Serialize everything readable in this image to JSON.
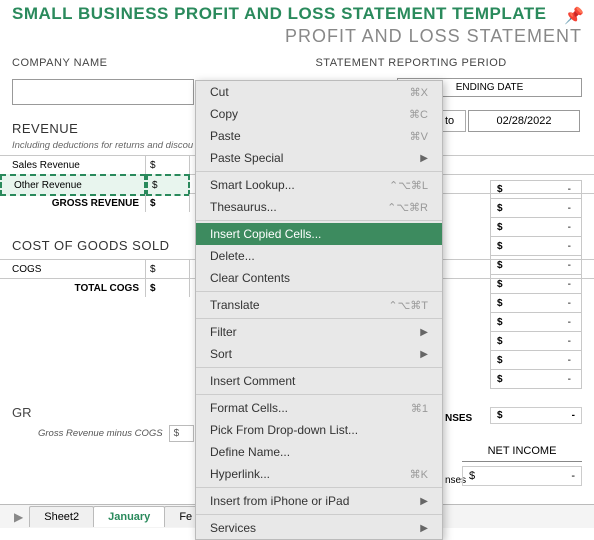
{
  "header": {
    "title": "SMALL BUSINESS PROFIT AND LOSS STATEMENT TEMPLATE",
    "subtitle": "PROFIT AND LOSS STATEMENT"
  },
  "labels": {
    "company": "COMPANY NAME",
    "statement_period": "STATEMENT REPORTING PERIOD",
    "ending_date": "ENDING DATE",
    "to": "to",
    "revenue": "REVENUE",
    "deductions": "Including deductions for returns and discou",
    "cogs": "COST OF GOODS SOLD",
    "gross_label": "GR",
    "gross_sub": "Gross Revenue minus COGS",
    "net_income": "NET INCOME",
    "nses": "nses",
    "nses2": "NSES"
  },
  "statement": {
    "ending_date_value": "02/28/2022"
  },
  "revenue_rows": [
    {
      "label": "Sales Revenue",
      "cur": "$"
    },
    {
      "label": "Other Revenue",
      "cur": "$",
      "selected": true
    },
    {
      "label": "GROSS REVENUE",
      "cur": "$",
      "bold": true
    }
  ],
  "cogs_rows": [
    {
      "label": "COGS",
      "cur": "$"
    },
    {
      "label": "TOTAL COGS",
      "cur": "$",
      "bold": true
    }
  ],
  "dollar_rows": [
    {
      "s": "$",
      "v": "-"
    },
    {
      "s": "$",
      "v": "-"
    },
    {
      "s": "$",
      "v": "-"
    },
    {
      "s": "$",
      "v": "-"
    },
    {
      "s": "$",
      "v": "-"
    },
    {
      "s": "$",
      "v": "-"
    },
    {
      "s": "$",
      "v": "-"
    },
    {
      "s": "$",
      "v": "-"
    },
    {
      "s": "$",
      "v": "-"
    },
    {
      "s": "$",
      "v": "-"
    },
    {
      "s": "$",
      "v": "-"
    }
  ],
  "netincome": {
    "s": "$",
    "v": "-"
  },
  "gross_mini": {
    "s": "$",
    "v": ""
  },
  "nses2box": {
    "s": "$",
    "v": "-"
  },
  "context_menu": [
    {
      "label": "Cut",
      "shortcut": "⌘X"
    },
    {
      "label": "Copy",
      "shortcut": "⌘C"
    },
    {
      "label": "Paste",
      "shortcut": "⌘V"
    },
    {
      "label": "Paste Special",
      "arrow": true
    },
    {
      "sep": true
    },
    {
      "label": "Smart Lookup...",
      "shortcut": "⌃⌥⌘L"
    },
    {
      "label": "Thesaurus...",
      "shortcut": "⌃⌥⌘R"
    },
    {
      "sep": true
    },
    {
      "label": "Insert Copied Cells...",
      "highlight": true
    },
    {
      "label": "Delete..."
    },
    {
      "label": "Clear Contents"
    },
    {
      "sep": true
    },
    {
      "label": "Translate",
      "shortcut": "⌃⌥⌘T"
    },
    {
      "sep": true
    },
    {
      "label": "Filter",
      "arrow": true
    },
    {
      "label": "Sort",
      "arrow": true
    },
    {
      "sep": true
    },
    {
      "label": "Insert Comment"
    },
    {
      "sep": true
    },
    {
      "label": "Format Cells...",
      "shortcut": "⌘1"
    },
    {
      "label": "Pick From Drop-down List..."
    },
    {
      "label": "Define Name..."
    },
    {
      "label": "Hyperlink...",
      "shortcut": "⌘K"
    },
    {
      "sep": true
    },
    {
      "label": "Insert from iPhone or iPad",
      "arrow": true
    },
    {
      "sep": true
    },
    {
      "label": "Services",
      "arrow": true
    }
  ],
  "tabs": {
    "items": [
      "Sheet2",
      "January",
      "Fe"
    ],
    "active": 1,
    "nav": "▶"
  }
}
